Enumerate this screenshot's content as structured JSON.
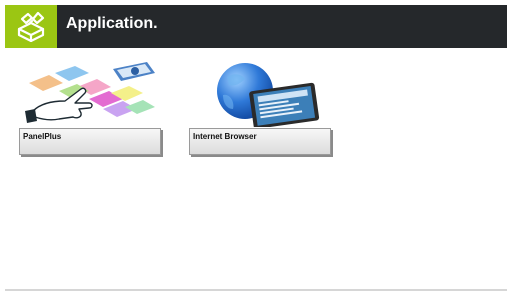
{
  "header": {
    "title": "Application.",
    "icon": "app-box-icon",
    "accent_color": "#9bc613",
    "bar_color": "#25282b"
  },
  "apps": [
    {
      "label": "PanelPlus",
      "icon": "panelplus-tiles-icon"
    },
    {
      "label": "Internet Browser",
      "icon": "globe-browser-icon"
    }
  ]
}
